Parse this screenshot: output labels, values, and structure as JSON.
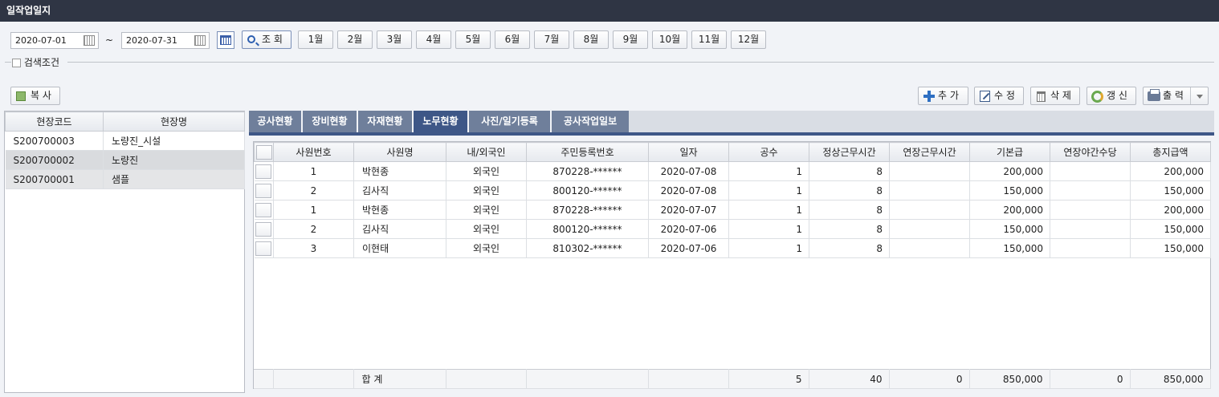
{
  "window": {
    "title": "일작업일지"
  },
  "toolbar": {
    "date_from": "2020-07-01",
    "date_sep": "~",
    "date_to": "2020-07-31",
    "search_label": "조 회",
    "months": [
      "1월",
      "2월",
      "3월",
      "4월",
      "5월",
      "6월",
      "7월",
      "8월",
      "9월",
      "10월",
      "11월",
      "12월"
    ],
    "search_condition_label": "검색조건"
  },
  "actions": {
    "copy": "복 사",
    "add": "추 가",
    "edit": "수 정",
    "delete": "삭 제",
    "refresh": "갱 신",
    "print": "출 력"
  },
  "sites": {
    "columns": [
      "현장코드",
      "현장명"
    ],
    "rows": [
      {
        "code": "S200700003",
        "name": "노량진_시설"
      },
      {
        "code": "S200700002",
        "name": "노량진"
      },
      {
        "code": "S200700001",
        "name": "샘플"
      }
    ]
  },
  "tabs": [
    "공사현황",
    "장비현황",
    "자재현황",
    "노무현황",
    "사진/일기등록",
    "공사작업일보"
  ],
  "active_tab": "노무현황",
  "labor": {
    "columns": [
      "사원번호",
      "사원명",
      "내/외국인",
      "주민등록번호",
      "일자",
      "공수",
      "정상근무시간",
      "연장근무시간",
      "기본급",
      "연장야간수당",
      "총지급액"
    ],
    "rows": [
      {
        "emp_no": "1",
        "name": "박현종",
        "nationality": "외국인",
        "rrn": "870228-******",
        "date": "2020-07-08",
        "units": "1",
        "normal_hours": "8",
        "overtime_hours": "",
        "base_pay": "200,000",
        "night_allowance": "",
        "total": "200,000"
      },
      {
        "emp_no": "2",
        "name": "김사직",
        "nationality": "외국인",
        "rrn": "800120-******",
        "date": "2020-07-08",
        "units": "1",
        "normal_hours": "8",
        "overtime_hours": "",
        "base_pay": "150,000",
        "night_allowance": "",
        "total": "150,000"
      },
      {
        "emp_no": "1",
        "name": "박현종",
        "nationality": "외국인",
        "rrn": "870228-******",
        "date": "2020-07-07",
        "units": "1",
        "normal_hours": "8",
        "overtime_hours": "",
        "base_pay": "200,000",
        "night_allowance": "",
        "total": "200,000"
      },
      {
        "emp_no": "2",
        "name": "김사직",
        "nationality": "외국인",
        "rrn": "800120-******",
        "date": "2020-07-06",
        "units": "1",
        "normal_hours": "8",
        "overtime_hours": "",
        "base_pay": "150,000",
        "night_allowance": "",
        "total": "150,000"
      },
      {
        "emp_no": "3",
        "name": "이현태",
        "nationality": "외국인",
        "rrn": "810302-******",
        "date": "2020-07-06",
        "units": "1",
        "normal_hours": "8",
        "overtime_hours": "",
        "base_pay": "150,000",
        "night_allowance": "",
        "total": "150,000"
      }
    ],
    "totals": {
      "label": "합 계",
      "units": "5",
      "normal_hours": "40",
      "overtime_hours": "0",
      "base_pay": "850,000",
      "night_allowance": "0",
      "total": "850,000"
    }
  }
}
